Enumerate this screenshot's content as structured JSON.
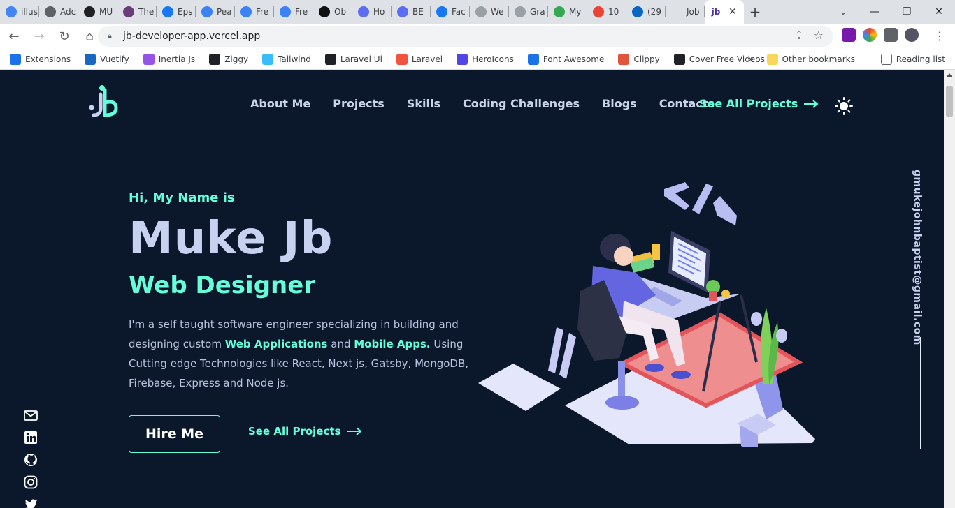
{
  "browser": {
    "tabs": [
      {
        "label": "illus",
        "icon": "google-icon",
        "color": "#4285f4"
      },
      {
        "label": "Adc",
        "icon": "globe-icon",
        "color": "#5f6368"
      },
      {
        "label": "MU",
        "icon": "github-icon",
        "color": "#202124"
      },
      {
        "label": "The",
        "icon": "site-icon",
        "color": "#6a3d7a"
      },
      {
        "label": "Eps",
        "icon": "facebook-icon",
        "color": "#1877f2"
      },
      {
        "label": "Pea",
        "icon": "react-icon",
        "color": "#3b82f6"
      },
      {
        "label": "Fre",
        "icon": "react-icon",
        "color": "#3b82f6"
      },
      {
        "label": "Fre",
        "icon": "react-icon",
        "color": "#3b82f6"
      },
      {
        "label": "Ob",
        "icon": "site-icon",
        "color": "#111111"
      },
      {
        "label": "Ho",
        "icon": "canva-icon",
        "color": "#5b6df0"
      },
      {
        "label": "BE",
        "icon": "canva-icon",
        "color": "#5b6df0"
      },
      {
        "label": "Fac",
        "icon": "facebook-icon",
        "color": "#1877f2"
      },
      {
        "label": "We",
        "icon": "globe-icon",
        "color": "#9aa0a6"
      },
      {
        "label": "Gra",
        "icon": "globe-icon",
        "color": "#9aa0a6"
      },
      {
        "label": "My",
        "icon": "drive-icon",
        "color": "#34a853"
      },
      {
        "label": "10",
        "icon": "gmail-icon",
        "color": "#ea4335"
      },
      {
        "label": "(29",
        "icon": "linkedin-icon",
        "color": "#0a66c2"
      },
      {
        "label": "Job",
        "icon": "blank-icon",
        "color": "#dee1e6"
      }
    ],
    "active_tab_icon": "jb-icon",
    "url": "jb-developer-app.vercel.app",
    "bookmarks": [
      {
        "label": "Extensions",
        "icon": "puzzle-icon",
        "color": "#1a73e8"
      },
      {
        "label": "Vuetify",
        "icon": "vuetify-icon",
        "color": "#1867c0"
      },
      {
        "label": "Inertia Js",
        "icon": "inertia-icon",
        "color": "#9553e9"
      },
      {
        "label": "Ziggy",
        "icon": "github-icon",
        "color": "#202124"
      },
      {
        "label": "Tailwind",
        "icon": "tailwind-icon",
        "color": "#38bdf8"
      },
      {
        "label": "Laravel Ui",
        "icon": "github-icon",
        "color": "#202124"
      },
      {
        "label": "Laravel",
        "icon": "laravel-icon",
        "color": "#f05340"
      },
      {
        "label": "HeroIcons",
        "icon": "flag-icon",
        "color": "#5046e5"
      },
      {
        "label": "Font Awesome",
        "icon": "flag-outline-icon",
        "color": "#1a73e8"
      },
      {
        "label": "Clippy",
        "icon": "clippy-icon",
        "color": "#e0533d"
      },
      {
        "label": "Cover Free Videos",
        "icon": "coverr-icon",
        "color": "#202124"
      }
    ],
    "bookmarks_more": "»",
    "other_bookmarks": "Other bookmarks",
    "reading_list": "Reading list"
  },
  "site": {
    "nav": [
      "About Me",
      "Projects",
      "Skills",
      "Coding Challenges",
      "Blogs",
      "Contacts"
    ],
    "nav_cta": "See All Projects",
    "greeting": "Hi, My Name is",
    "name": "Muke Jb",
    "role": "Web Designer",
    "bio_1": "I'm a self taught software engineer specializing in building and designing custom ",
    "bio_hl1": "Web Applications",
    "bio_2": " and ",
    "bio_hl2": "Mobile Apps.",
    "bio_3": " Using Cutting edge Technologies like React, Next js, Gatsby, MongoDB, Firebase, Express and Node js.",
    "hire_button": "Hire Me",
    "cta_secondary": "See All Projects",
    "email": "gmukejohnbaptist@gmail.com",
    "accent_color": "#64ffda",
    "background_color": "#0b172a"
  }
}
